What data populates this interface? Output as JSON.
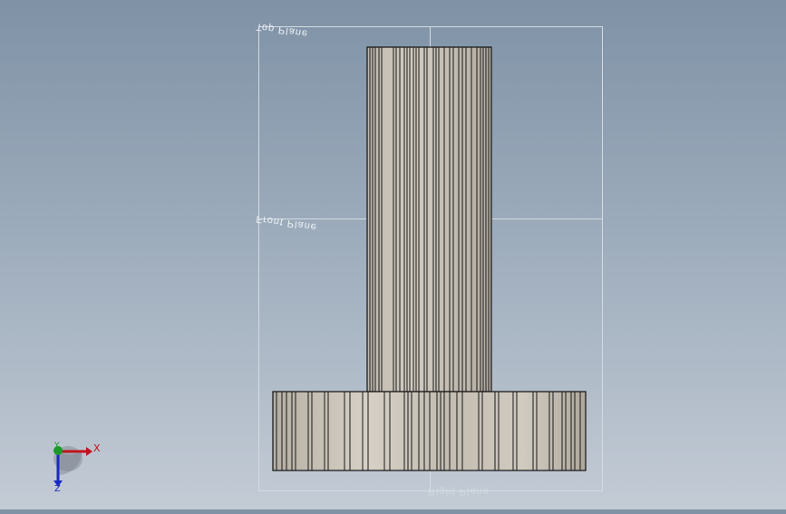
{
  "viewport": {
    "planes": {
      "top_label": "Top Plane",
      "front_label": "Front Plane",
      "right_label": "Right Plane"
    },
    "triad": {
      "x_label": "X",
      "y_label": "Y",
      "z_label": "Z"
    },
    "colors": {
      "background_top": "#7f92a6",
      "background_bottom": "#c3cbd5",
      "part_face": "#c9c3b8",
      "edge": "#111111",
      "x_axis": "#c0141c",
      "y_axis": "#1a9a2a",
      "z_axis": "#1a2ac0"
    }
  }
}
